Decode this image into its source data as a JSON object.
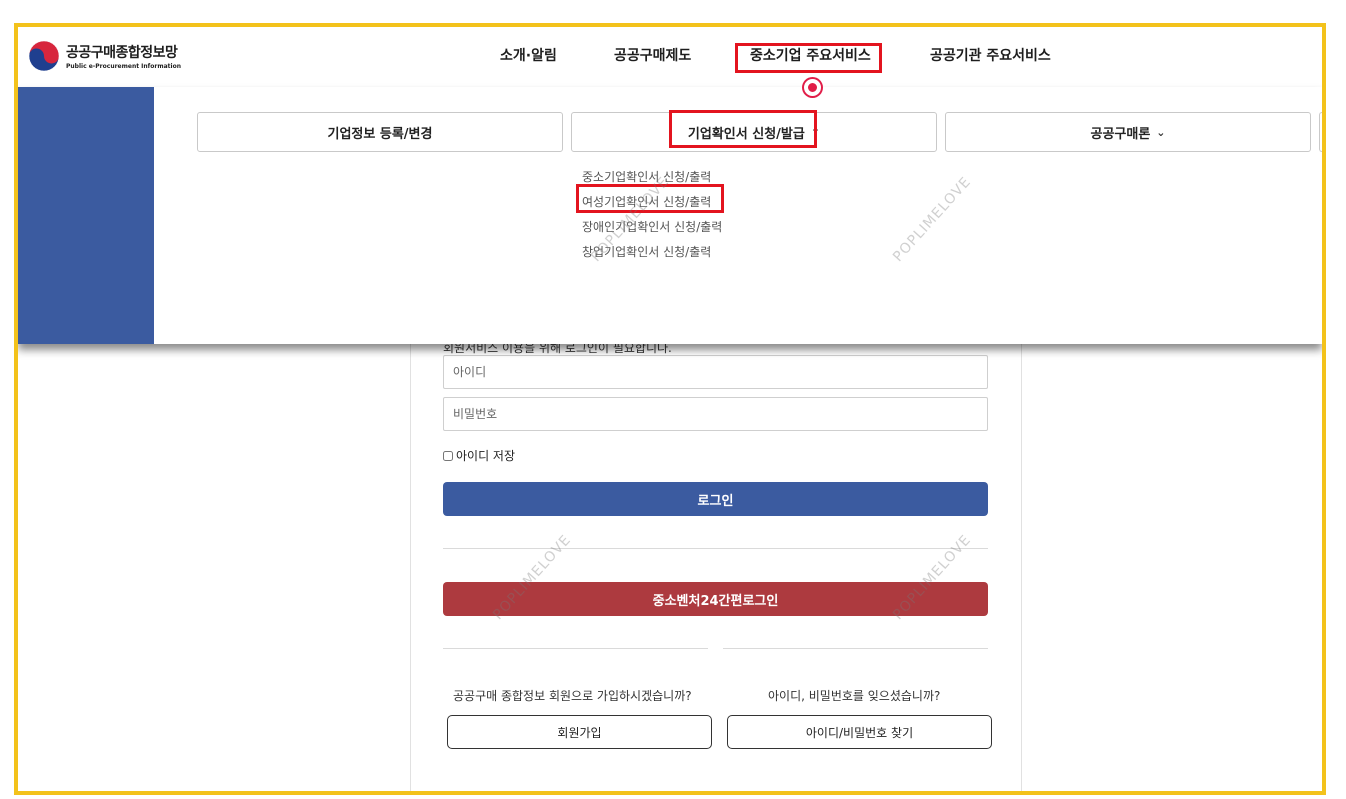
{
  "header": {
    "logo_title": "공공구매종합정보망",
    "logo_subtitle": "Public e-Procurement Information",
    "nav": [
      {
        "label": "소개·알림"
      },
      {
        "label": "공공구매제도"
      },
      {
        "label": "중소기업 주요서비스",
        "highlighted": true
      },
      {
        "label": "공공기관 주요서비스"
      }
    ]
  },
  "mega_menu": {
    "tabs": [
      {
        "label": "기업정보 등록/변경",
        "chevron": ""
      },
      {
        "label": "기업확인서 신청/발급",
        "chevron": "⌃",
        "expanded": true,
        "highlighted": true
      },
      {
        "label": "공공구매론",
        "chevron": "⌄"
      }
    ],
    "submenu": [
      {
        "label": "중소기업확인서 신청/출력"
      },
      {
        "label": "여성기업확인서 신청/출력",
        "highlighted": true
      },
      {
        "label": "장애인기업확인서 신청/출력"
      },
      {
        "label": "창업기업확인서 신청/출력"
      }
    ]
  },
  "login": {
    "notice": "회원서비스 이용을 위해 로그인이 필요합니다.",
    "id_placeholder": "아이디",
    "password_placeholder": "비밀번호",
    "remember_label": "아이디 저장",
    "login_button": "로그인",
    "sme_login_button": "중소벤처24간편로그인",
    "signup_question": "공공구매 종합정보 회원으로 가입하시겠습니까?",
    "signup_button": "회원가입",
    "find_question": "아이디, 비밀번호를 잊으셨습니까?",
    "find_button": "아이디/비밀번호 찾기"
  },
  "watermark": "POPLIMELOVE",
  "colors": {
    "frame": "#f3c21b",
    "highlight": "#e3141f",
    "side_panel": "#3b5ba0",
    "login_button": "#3b5ba0",
    "sme_button": "#ad3a3f",
    "cursor": "#e11d48"
  }
}
